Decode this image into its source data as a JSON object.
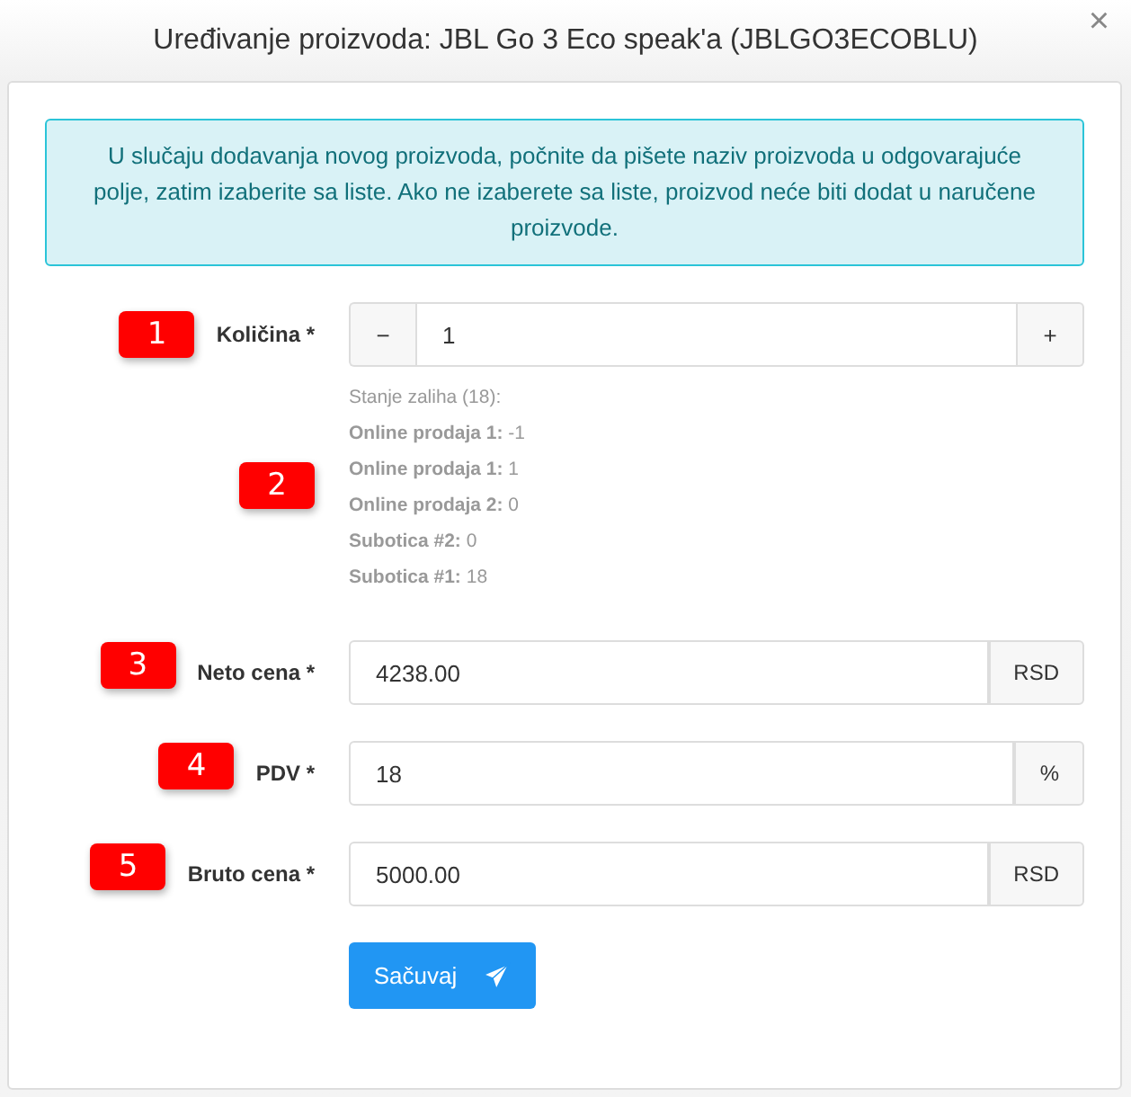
{
  "dialog": {
    "title": "Uređivanje proizvoda: JBL Go 3 Eco speak'a (JBLGO3ECOBLU)",
    "close": "×"
  },
  "alert": "U slučaju dodavanja novog proizvoda, počnite da pišete naziv proizvoda u odgovarajuće polje, zatim izaberite sa liste. Ako ne izaberete sa liste, proizvod neće biti dodat u naručene proizvode.",
  "fields": [
    {
      "kind": "stepper",
      "marker": "1",
      "label": "Količina *",
      "value": "1",
      "minus": "−",
      "plus": "+"
    },
    {
      "kind": "addon",
      "marker": "3",
      "label": "Neto cena *",
      "value": "4238.00",
      "addon": "RSD"
    },
    {
      "kind": "addon",
      "marker": "4",
      "label": "PDV *",
      "value": "18",
      "addon": "%"
    },
    {
      "kind": "addon",
      "marker": "5",
      "label": "Bruto cena *",
      "value": "5000.00",
      "addon": "RSD"
    }
  ],
  "stock": {
    "marker": "2",
    "title": "Stanje zaliha (18):",
    "lines": [
      "**Online prodaja 1:** -1",
      "**Online prodaja 1:** 1",
      "**Online prodaja 2:** 0",
      "**Subotica #2:** 0",
      "**Subotica #1:** 18"
    ]
  },
  "save_button": "Sačuvaj"
}
